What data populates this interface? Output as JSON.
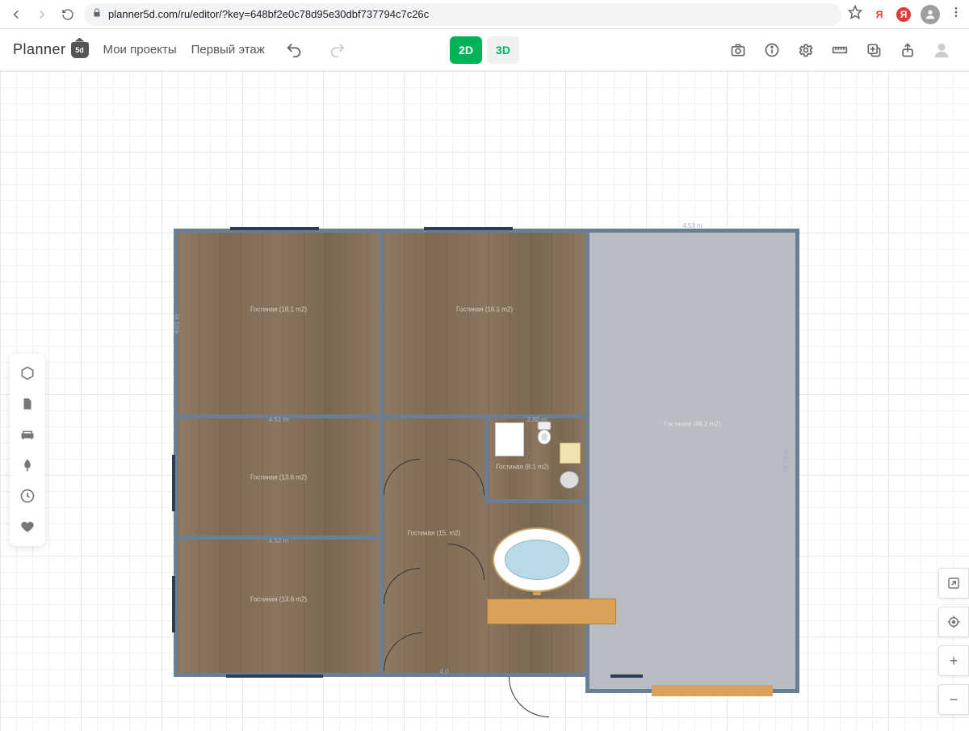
{
  "browser": {
    "url": "planner5d.com/ru/editor/?key=648bf2e0c78d95e30dbf737794c7c26c",
    "ext1": "Я",
    "ext2": "Я"
  },
  "logo": {
    "brand": "Planner",
    "badge": "5d"
  },
  "breadcrumbs": {
    "projects": "Мои проекты",
    "floor": "Первый этаж"
  },
  "view": {
    "v2d": "2D",
    "v3d": "3D"
  },
  "rooms": {
    "tl": {
      "label": "Гостиная (18.1 m2)"
    },
    "tc": {
      "label": "Гостиная (16.1 m2)"
    },
    "ml": {
      "label": "Гостиная (13.6 m2)",
      "dim_top": "4.51 m"
    },
    "bl": {
      "label": "Гостиная (13.6 m2)",
      "dim_top": "4.52 m"
    },
    "bath": {
      "label": "Гостиная (8.1 m2)",
      "dim_top": "2.62 m"
    },
    "hall": {
      "label": "Гостиная (15. m2)"
    },
    "right": {
      "label": "Гостиная (46.2 m2)",
      "dim_top": "4.53 m",
      "dim_right": "10.19 m"
    }
  },
  "dims": {
    "left_side": "4.01 m",
    "bottom": "4.0"
  },
  "fixtures": {
    "small_box": ""
  },
  "rt": {
    "plus": "+",
    "minus": "−"
  }
}
